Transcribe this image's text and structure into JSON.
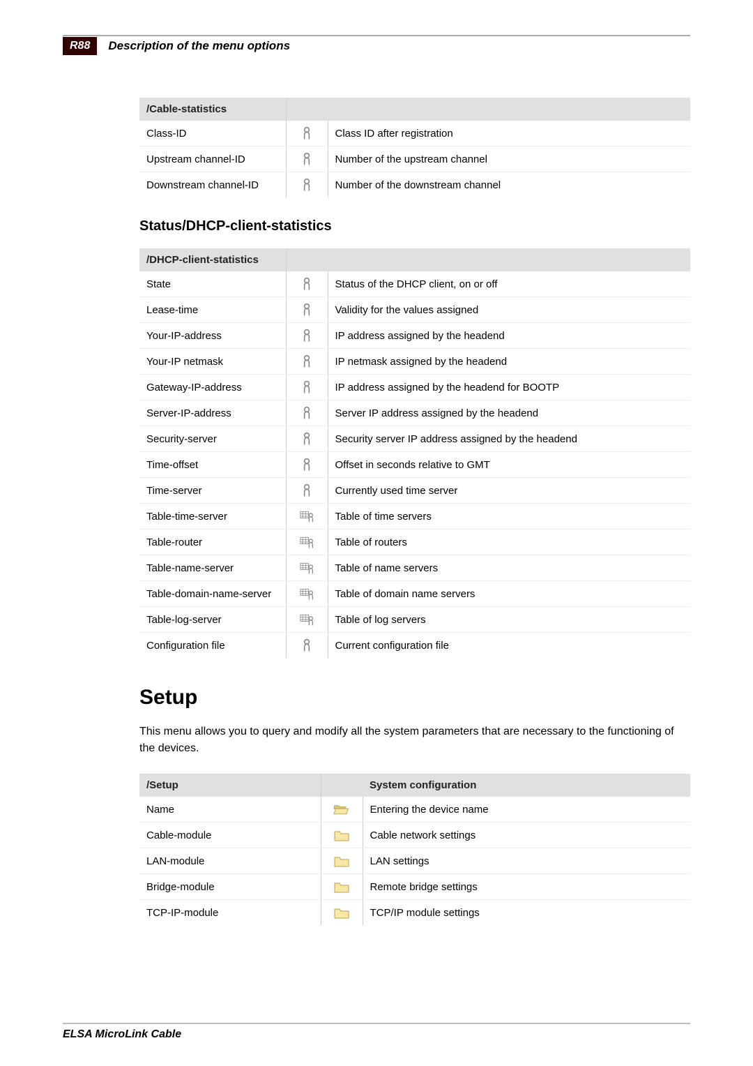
{
  "header": {
    "badge": "R88",
    "title": "Description of the menu options"
  },
  "table1": {
    "header_path": "/Cable-statistics",
    "rows": [
      {
        "name": "Class-ID",
        "icon": "info",
        "desc": "Class ID after registration"
      },
      {
        "name": "Upstream channel-ID",
        "icon": "info",
        "desc": "Number of the upstream channel"
      },
      {
        "name": "Downstream channel-ID",
        "icon": "info",
        "desc": "Number of the downstream channel"
      }
    ]
  },
  "section1_heading": "Status/DHCP-client-statistics",
  "table2": {
    "header_path": "/DHCP-client-statistics",
    "rows": [
      {
        "name": "State",
        "icon": "info",
        "desc": "Status of the DHCP client, on or off"
      },
      {
        "name": "Lease-time",
        "icon": "info",
        "desc": "Validity for the values assigned"
      },
      {
        "name": "Your-IP-address",
        "icon": "info",
        "desc": "IP address assigned by the headend"
      },
      {
        "name": "Your-IP netmask",
        "icon": "info",
        "desc": "IP netmask assigned by the headend"
      },
      {
        "name": "Gateway-IP-address",
        "icon": "info",
        "desc": "IP address assigned by the headend for BOOTP"
      },
      {
        "name": "Server-IP-address",
        "icon": "info",
        "desc": "Server IP address assigned by the headend"
      },
      {
        "name": "Security-server",
        "icon": "info",
        "desc": "Security server IP address assigned by the headend"
      },
      {
        "name": "Time-offset",
        "icon": "info",
        "desc": "Offset in seconds relative to GMT"
      },
      {
        "name": "Time-server",
        "icon": "info",
        "desc": "Currently used time server"
      },
      {
        "name": "Table-time-server",
        "icon": "table",
        "desc": "Table of time servers"
      },
      {
        "name": "Table-router",
        "icon": "table",
        "desc": "Table of routers"
      },
      {
        "name": "Table-name-server",
        "icon": "table",
        "desc": "Table of name servers"
      },
      {
        "name": "Table-domain-name-server",
        "icon": "table",
        "desc": "Table of domain name servers"
      },
      {
        "name": "Table-log-server",
        "icon": "table",
        "desc": "Table of log servers"
      },
      {
        "name": "Configuration file",
        "icon": "info",
        "desc": "Current configuration file"
      }
    ]
  },
  "setup": {
    "heading": "Setup",
    "text": "This menu allows you to query and modify all the system parameters that are necessary to the functioning of the devices.",
    "header_path": "/Setup",
    "header_right": "System configuration",
    "rows": [
      {
        "name": "Name",
        "icon": "folder-open",
        "desc": "Entering the device name"
      },
      {
        "name": "Cable-module",
        "icon": "folder",
        "desc": "Cable network settings"
      },
      {
        "name": "LAN-module",
        "icon": "folder",
        "desc": "LAN settings"
      },
      {
        "name": "Bridge-module",
        "icon": "folder",
        "desc": "Remote bridge settings"
      },
      {
        "name": "TCP-IP-module",
        "icon": "folder",
        "desc": "TCP/IP module settings"
      }
    ]
  },
  "footer": "ELSA MicroLink Cable"
}
